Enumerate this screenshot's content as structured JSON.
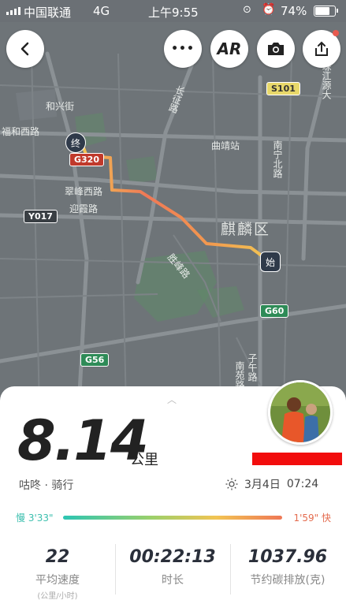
{
  "status_bar": {
    "carrier": "中国联通",
    "network": "4G",
    "time": "上午9:55",
    "battery": "74%"
  },
  "toolbar": {
    "back_icon": "chevron-left-icon",
    "more_label": "•••",
    "ar_label": "AR",
    "camera_icon": "camera-icon",
    "share_icon": "share-icon"
  },
  "map": {
    "labels": {
      "hexing_street": "和兴街",
      "fuhe_west_road": "福和西路",
      "cuifeng_west_road": "翠峰西路",
      "yingxia_road": "迎霞路",
      "changzheng_road": "长征路",
      "qujing_station": "曲靖站",
      "nanning_north_road": "南宁北路",
      "zhujiang_road": "珠江源大",
      "qilin_district": "麒麟区",
      "shengfeng_road": "胜峰路",
      "ziwu_road": "子午路",
      "nanyuan_road": "南苑路"
    },
    "road_badges": {
      "s101": "S101",
      "g320": "G320",
      "y017": "Y017",
      "g60": "G60",
      "g56": "G56"
    },
    "start_marker": "始",
    "end_marker": "终",
    "route_gradient": [
      "#f2c453",
      "#ef7856"
    ]
  },
  "summary": {
    "distance": "8.14",
    "distance_unit": "公里",
    "activity": "咕咚 · 骑行",
    "date": "3月4日",
    "time": "07:24",
    "pace_slow_label": "慢 3'33\"",
    "pace_fast_label": "1'59\" 快",
    "pace_colors": [
      "#2cc5b3",
      "#ef7856"
    ]
  },
  "stats": [
    {
      "value": "22",
      "label": "平均速度",
      "sub": "(公里/小时)"
    },
    {
      "value": "00:22:13",
      "label": "时长",
      "sub": ""
    },
    {
      "value": "1037.96",
      "label": "节约碳排放(克)",
      "sub": ""
    }
  ]
}
